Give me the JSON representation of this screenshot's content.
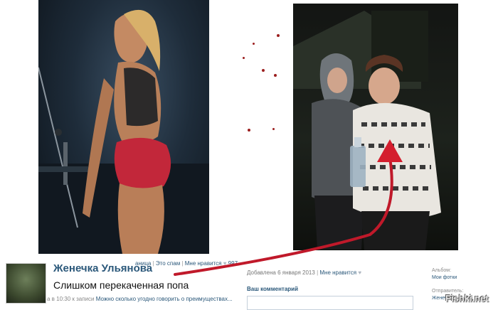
{
  "post": {
    "author_name": "Женечка Ульянова",
    "status_text": "Слишком перекаченная попа",
    "under_time": "а в 10:30 к записи",
    "under_comment": "Можно сколько угодно говорить о преимуществах..."
  },
  "photo_meta": {
    "page_fragment": "аница",
    "spam_link": "Это спам",
    "like_link": "Мне нравится",
    "like_count": "997",
    "added_text": "Добавлена 6 января 2013",
    "added_like": "Мне нравится"
  },
  "comment": {
    "label": "Ваш комментарий"
  },
  "sidebar": {
    "album_label": "Альбом:",
    "album_value": "Мои фотки",
    "sender_label": "Отправитель:",
    "sender_value": "Женеч"
  },
  "watermark": "Fishki.net",
  "colors": {
    "link_blue": "#2b587a",
    "arrow_red": "#c0192a"
  },
  "icons": {
    "like": "heart-icon",
    "arrow": "red-arrow-icon"
  }
}
